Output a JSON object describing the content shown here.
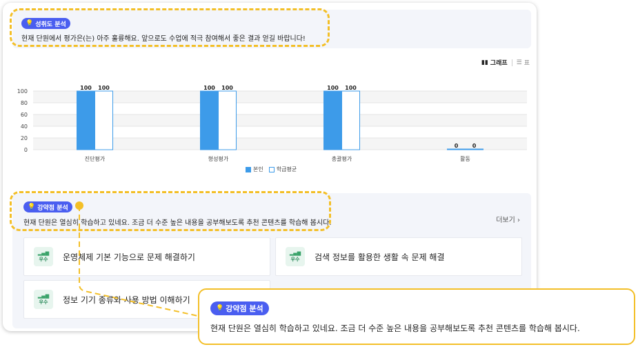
{
  "achievement": {
    "badge": "성취도 분석",
    "message": "현재 단원에서 평가은(는) 아주 훌륭해요. 앞으로도 수업에 적극 참여해서 좋은 결과 얻길 바랍니다!"
  },
  "view_toggle": {
    "graph_label": "그래프",
    "table_label": "표"
  },
  "chart_data": {
    "type": "bar",
    "categories": [
      "진단평가",
      "형성평가",
      "총괄평가",
      "활동"
    ],
    "series": [
      {
        "name": "본인",
        "values": [
          100,
          100,
          100,
          0
        ],
        "color": "#3d9be9"
      },
      {
        "name": "학급평균",
        "values": [
          100,
          100,
          100,
          0
        ],
        "color": "#ffffff"
      }
    ],
    "yticks": [
      0,
      20,
      40,
      60,
      80,
      100
    ],
    "ylim": [
      0,
      100
    ],
    "grid": true,
    "legend": "bottom"
  },
  "weakness": {
    "badge": "강약점 분석",
    "message": "현재 단원은 열심히 학습하고 있네요. 조금 더 수준 높은 내용을 공부해보도록 추천 콘텐츠를 학습해 봅시다.",
    "more_label": "더보기",
    "items": [
      {
        "grade": "우수",
        "title": "운영체제 기본 기능으로 문제 해결하기"
      },
      {
        "grade": "우수",
        "title": "검색 정보를 활용한 생활 속 문제 해결"
      },
      {
        "grade": "우수",
        "title": "정보 기기 종류와 사용 방법 이해하기"
      }
    ]
  },
  "callout": {
    "badge": "강약점 분석",
    "message": "현재 단원은 열심히 학습하고 있네요. 조금 더 수준 높은 내용을 공부해보도록 추천 콘텐츠를 학습해 봅시다."
  }
}
